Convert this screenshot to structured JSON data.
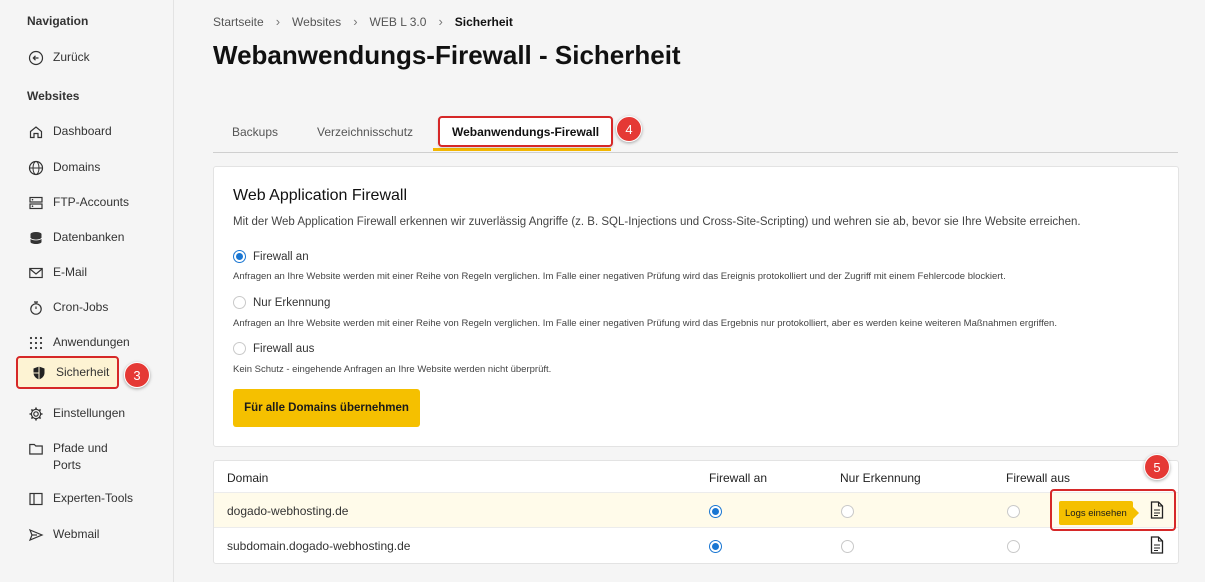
{
  "sidebar": {
    "nav_heading": "Navigation",
    "back_label": "Zurück",
    "websites_heading": "Websites",
    "items": [
      {
        "label": "Dashboard",
        "icon": "home-icon"
      },
      {
        "label": "Domains",
        "icon": "globe-icon"
      },
      {
        "label": "FTP-Accounts",
        "icon": "server-icon"
      },
      {
        "label": "Datenbanken",
        "icon": "database-icon"
      },
      {
        "label": "E-Mail",
        "icon": "mail-icon"
      },
      {
        "label": "Cron-Jobs",
        "icon": "stopwatch-icon"
      },
      {
        "label": "Anwendungen",
        "icon": "grid-dots-icon"
      },
      {
        "label": "Sicherheit",
        "icon": "shield-icon"
      },
      {
        "label": "Einstellungen",
        "icon": "gear-icon"
      },
      {
        "label": "Pfade und Ports",
        "icon": "folder-icon"
      },
      {
        "label": "Experten-Tools",
        "icon": "panel-icon"
      },
      {
        "label": "Webmail",
        "icon": "send-icon"
      }
    ]
  },
  "badges": {
    "b3": "3",
    "b4": "4",
    "b5": "5"
  },
  "breadcrumb": [
    "Startseite",
    "Websites",
    "WEB L 3.0",
    "Sicherheit"
  ],
  "page_title": "Webanwendungs-Firewall - Sicherheit",
  "tabs": [
    "Backups",
    "Verzeichnisschutz",
    "Webanwendungs-Firewall"
  ],
  "card": {
    "title": "Web Application Firewall",
    "description": "Mit der Web Application Firewall erkennen wir zuverlässig Angriffe (z. B. SQL-Injections und Cross-Site-Scripting) und wehren sie ab, bevor sie Ihre Website erreichen.",
    "options": [
      {
        "label": "Firewall an",
        "desc": "Anfragen an Ihre Website werden mit einer Reihe von Regeln verglichen. Im Falle einer negativen Prüfung wird das Ereignis protokolliert und der Zugriff mit einem Fehlercode blockiert.",
        "selected": true
      },
      {
        "label": "Nur Erkennung",
        "desc": "Anfragen an Ihre Website werden mit einer Reihe von Regeln verglichen. Im Falle einer negativen Prüfung wird das Ergebnis nur protokolliert, aber es werden keine weiteren Maßnahmen ergriffen.",
        "selected": false
      },
      {
        "label": "Firewall aus",
        "desc": "Kein Schutz - eingehende Anfragen an Ihre Website werden nicht überprüft.",
        "selected": false
      }
    ],
    "apply_button": "Für alle Domains übernehmen"
  },
  "table": {
    "headers": [
      "Domain",
      "Firewall an",
      "Nur Erkennung",
      "Firewall aus"
    ],
    "rows": [
      {
        "domain": "dogado-webhosting.de",
        "selected": "Firewall an"
      },
      {
        "domain": "subdomain.dogado-webhosting.de",
        "selected": "Firewall an"
      }
    ],
    "logs_tooltip": "Logs einsehen"
  },
  "colors": {
    "accent": "#f5c000",
    "highlight": "#d62828",
    "radio": "#1976d2"
  }
}
